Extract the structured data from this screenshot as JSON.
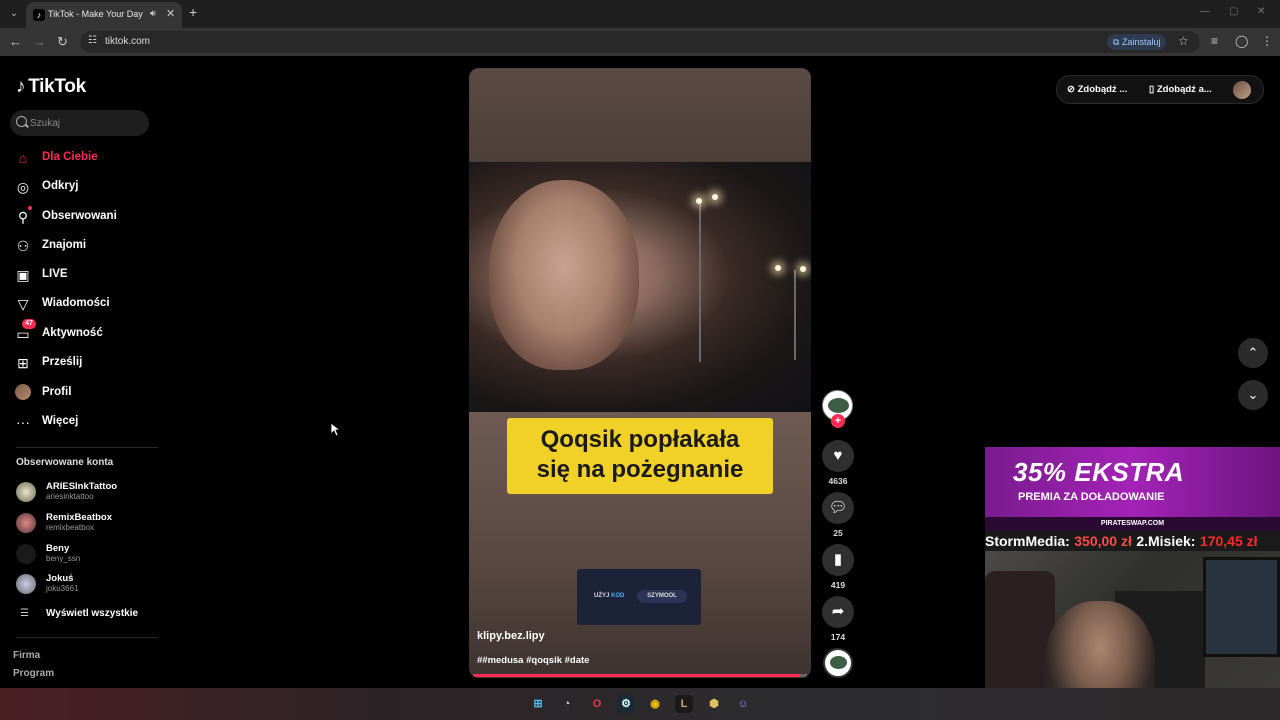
{
  "browser": {
    "tab_title": "TikTok - Make Your Day",
    "url": "tiktok.com",
    "install_label": "Zainstaluj"
  },
  "sidebar": {
    "logo": "TikTok",
    "search_placeholder": "Szukaj",
    "nav": [
      {
        "label": "Dla Ciebie",
        "icon": "home-icon",
        "active": true
      },
      {
        "label": "Odkryj",
        "icon": "compass-icon"
      },
      {
        "label": "Obserwowani",
        "icon": "following-icon"
      },
      {
        "label": "Znajomi",
        "icon": "friends-icon"
      },
      {
        "label": "LIVE",
        "icon": "live-icon"
      },
      {
        "label": "Wiadomości",
        "icon": "messages-icon"
      },
      {
        "label": "Aktywność",
        "icon": "activity-icon",
        "badge": "47"
      },
      {
        "label": "Prześlij",
        "icon": "upload-icon"
      },
      {
        "label": "Profil",
        "icon": "profile-avatar"
      },
      {
        "label": "Więcej",
        "icon": "more-icon"
      }
    ],
    "followed_title": "Obserwowane konta",
    "followed": [
      {
        "name": "ARIESInkTattoo",
        "handle": "ariesinktattoo"
      },
      {
        "name": "RemixBeatbox",
        "handle": "remixbeatbox"
      },
      {
        "name": "Beny",
        "handle": "beny_ssn"
      },
      {
        "name": "Jokuś",
        "handle": "joku3661"
      }
    ],
    "see_all": "Wyświetl wszystkie",
    "footer": [
      "Firma",
      "Program"
    ]
  },
  "video": {
    "caption_line1": "Qoqsik popłakała",
    "caption_line2": "się na pożegnanie",
    "promo_use": "UŻYJ",
    "promo_kod": "KOD",
    "promo_code": "SZYMOOL",
    "author": "klipy.bez.lipy",
    "tags": "##medusa #qoqsik #date",
    "progress": 0.98
  },
  "actions": {
    "likes": "4636",
    "comments": "25",
    "saves": "419",
    "shares": "174"
  },
  "topbar": {
    "coins_label": "Zdobądź ...",
    "app_label": "Zdobądź a..."
  },
  "overlay": {
    "banner_big": "35% EKSTRA",
    "banner_small": "PREMIA ZA DOŁADOWANIE",
    "banner_site": "PIRATESWAP.COM",
    "ticker_name1": "StormMedia:",
    "ticker_amount1": "350,00 zł",
    "ticker_name2": "2.Misiek:",
    "ticker_amount2": "170,45 zł"
  },
  "colors": {
    "accent": "#fe2c55",
    "caption_bg": "#f1d027",
    "banner": "#a323b6"
  }
}
